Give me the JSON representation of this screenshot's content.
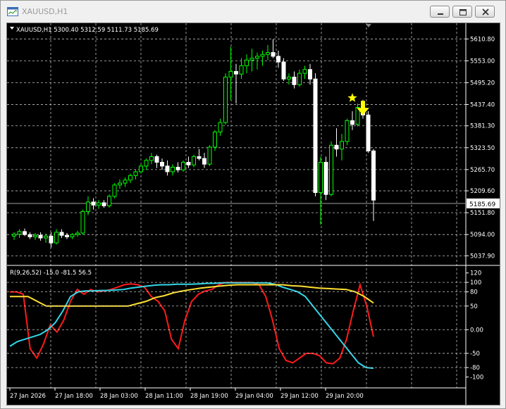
{
  "window": {
    "title": "XAUUSD,H1"
  },
  "chart_header": {
    "text": "XAUUSD,H1  5300.40 5312.59 5111.73 5185.69"
  },
  "price_axis": {
    "ticks": [
      "5610.80",
      "5553.00",
      "5495.20",
      "5437.40",
      "5381.30",
      "5323.50",
      "5265.70",
      "5209.60",
      "5151.80",
      "5094.00",
      "5037.90"
    ],
    "current_price": "5185.69"
  },
  "indicator": {
    "header": "R(9,26,52) -15.0 -81.5 56.5",
    "ticks": [
      "120",
      "100",
      "80",
      "50",
      "0.00",
      "-50",
      "-80",
      "-100"
    ]
  },
  "time_axis": {
    "labels": [
      "27 Jan 2026",
      "27 Jan 18:00",
      "28 Jan 03:00",
      "28 Jan 11:00",
      "28 Jan 19:00",
      "29 Jan 04:00",
      "29 Jan 12:00",
      "29 Jan 20:00"
    ]
  },
  "colors": {
    "background": "#000000",
    "grid": "#c0c0c0",
    "bull_candle": "#000000",
    "bull_outline": "#00ff00",
    "bear_candle": "#ffffff",
    "axis_text": "#ffffff",
    "red_line": "#ff1a1a",
    "cyan_line": "#33d6e8",
    "yellow_line": "#ffe033",
    "marker": "#ffff00"
  },
  "chart_data": {
    "type": "candlestick",
    "symbol": "XAUUSD",
    "timeframe": "H1",
    "ylim": [
      5020,
      5630
    ],
    "candles": [
      {
        "o": 5090,
        "h": 5100,
        "l": 5080,
        "c": 5095
      },
      {
        "o": 5095,
        "h": 5108,
        "l": 5085,
        "c": 5102
      },
      {
        "o": 5102,
        "h": 5110,
        "l": 5090,
        "c": 5094
      },
      {
        "o": 5094,
        "h": 5100,
        "l": 5082,
        "c": 5088
      },
      {
        "o": 5088,
        "h": 5098,
        "l": 5080,
        "c": 5092
      },
      {
        "o": 5092,
        "h": 5100,
        "l": 5078,
        "c": 5085
      },
      {
        "o": 5085,
        "h": 5096,
        "l": 5072,
        "c": 5090
      },
      {
        "o": 5090,
        "h": 5100,
        "l": 5060,
        "c": 5072
      },
      {
        "o": 5072,
        "h": 5108,
        "l": 5068,
        "c": 5100
      },
      {
        "o": 5100,
        "h": 5108,
        "l": 5085,
        "c": 5092
      },
      {
        "o": 5092,
        "h": 5098,
        "l": 5082,
        "c": 5088
      },
      {
        "o": 5088,
        "h": 5098,
        "l": 5082,
        "c": 5094
      },
      {
        "o": 5094,
        "h": 5104,
        "l": 5088,
        "c": 5098
      },
      {
        "o": 5098,
        "h": 5160,
        "l": 5094,
        "c": 5155
      },
      {
        "o": 5155,
        "h": 5195,
        "l": 5145,
        "c": 5180
      },
      {
        "o": 5180,
        "h": 5190,
        "l": 5160,
        "c": 5172
      },
      {
        "o": 5172,
        "h": 5185,
        "l": 5162,
        "c": 5178
      },
      {
        "o": 5178,
        "h": 5185,
        "l": 5165,
        "c": 5170
      },
      {
        "o": 5170,
        "h": 5200,
        "l": 5165,
        "c": 5195
      },
      {
        "o": 5195,
        "h": 5230,
        "l": 5190,
        "c": 5225
      },
      {
        "o": 5225,
        "h": 5240,
        "l": 5215,
        "c": 5230
      },
      {
        "o": 5230,
        "h": 5245,
        "l": 5220,
        "c": 5238
      },
      {
        "o": 5238,
        "h": 5255,
        "l": 5230,
        "c": 5250
      },
      {
        "o": 5250,
        "h": 5265,
        "l": 5240,
        "c": 5260
      },
      {
        "o": 5260,
        "h": 5280,
        "l": 5255,
        "c": 5275
      },
      {
        "o": 5275,
        "h": 5295,
        "l": 5265,
        "c": 5290
      },
      {
        "o": 5290,
        "h": 5310,
        "l": 5280,
        "c": 5300
      },
      {
        "o": 5300,
        "h": 5305,
        "l": 5270,
        "c": 5285
      },
      {
        "o": 5285,
        "h": 5295,
        "l": 5265,
        "c": 5275
      },
      {
        "o": 5275,
        "h": 5290,
        "l": 5250,
        "c": 5260
      },
      {
        "o": 5260,
        "h": 5280,
        "l": 5250,
        "c": 5272
      },
      {
        "o": 5272,
        "h": 5285,
        "l": 5258,
        "c": 5265
      },
      {
        "o": 5265,
        "h": 5290,
        "l": 5260,
        "c": 5285
      },
      {
        "o": 5285,
        "h": 5300,
        "l": 5270,
        "c": 5278
      },
      {
        "o": 5278,
        "h": 5305,
        "l": 5272,
        "c": 5300
      },
      {
        "o": 5300,
        "h": 5320,
        "l": 5290,
        "c": 5295
      },
      {
        "o": 5295,
        "h": 5310,
        "l": 5270,
        "c": 5280
      },
      {
        "o": 5280,
        "h": 5330,
        "l": 5275,
        "c": 5325
      },
      {
        "o": 5325,
        "h": 5370,
        "l": 5315,
        "c": 5365
      },
      {
        "o": 5365,
        "h": 5400,
        "l": 5355,
        "c": 5390
      },
      {
        "o": 5390,
        "h": 5520,
        "l": 5385,
        "c": 5510
      },
      {
        "o": 5510,
        "h": 5590,
        "l": 5450,
        "c": 5525
      },
      {
        "o": 5525,
        "h": 5545,
        "l": 5440,
        "c": 5518
      },
      {
        "o": 5518,
        "h": 5560,
        "l": 5505,
        "c": 5540
      },
      {
        "o": 5540,
        "h": 5570,
        "l": 5520,
        "c": 5555
      },
      {
        "o": 5555,
        "h": 5585,
        "l": 5525,
        "c": 5560
      },
      {
        "o": 5560,
        "h": 5575,
        "l": 5530,
        "c": 5565
      },
      {
        "o": 5565,
        "h": 5580,
        "l": 5540,
        "c": 5570
      },
      {
        "o": 5570,
        "h": 5595,
        "l": 5555,
        "c": 5575
      },
      {
        "o": 5575,
        "h": 5610,
        "l": 5560,
        "c": 5565
      },
      {
        "o": 5565,
        "h": 5580,
        "l": 5535,
        "c": 5550
      },
      {
        "o": 5550,
        "h": 5560,
        "l": 5500,
        "c": 5505
      },
      {
        "o": 5505,
        "h": 5520,
        "l": 5490,
        "c": 5510
      },
      {
        "o": 5510,
        "h": 5525,
        "l": 5480,
        "c": 5490
      },
      {
        "o": 5490,
        "h": 5530,
        "l": 5485,
        "c": 5520
      },
      {
        "o": 5520,
        "h": 5540,
        "l": 5505,
        "c": 5530
      },
      {
        "o": 5530,
        "h": 5545,
        "l": 5490,
        "c": 5505
      },
      {
        "o": 5505,
        "h": 5520,
        "l": 5195,
        "c": 5205
      },
      {
        "o": 5205,
        "h": 5300,
        "l": 5120,
        "c": 5285
      },
      {
        "o": 5285,
        "h": 5300,
        "l": 5185,
        "c": 5200
      },
      {
        "o": 5200,
        "h": 5340,
        "l": 5195,
        "c": 5330
      },
      {
        "o": 5330,
        "h": 5375,
        "l": 5300,
        "c": 5320
      },
      {
        "o": 5320,
        "h": 5360,
        "l": 5290,
        "c": 5340
      },
      {
        "o": 5340,
        "h": 5400,
        "l": 5330,
        "c": 5395
      },
      {
        "o": 5395,
        "h": 5420,
        "l": 5370,
        "c": 5385
      },
      {
        "o": 5385,
        "h": 5440,
        "l": 5380,
        "c": 5430
      },
      {
        "o": 5430,
        "h": 5450,
        "l": 5400,
        "c": 5410
      },
      {
        "o": 5410,
        "h": 5420,
        "l": 5310,
        "c": 5315
      },
      {
        "o": 5315,
        "h": 5320,
        "l": 5130,
        "c": 5185
      }
    ],
    "current_price": 5185.69,
    "markers": [
      {
        "type": "star",
        "candle": 64,
        "price": 5455
      },
      {
        "type": "arrow-down",
        "candle": 66,
        "price": 5425
      }
    ],
    "indicator": {
      "name": "R(9,26,52)",
      "ylim": [
        -120,
        130
      ],
      "series": [
        {
          "values": [
            80,
            80,
            75,
            -40,
            -60,
            -30,
            10,
            -5,
            20,
            60,
            85,
            75,
            85,
            80,
            82,
            85,
            90,
            95,
            97,
            95,
            90,
            70,
            60,
            40,
            -20,
            -40,
            20,
            60,
            75,
            82,
            85,
            95,
            100,
            100,
            100,
            100,
            100,
            95,
            70,
            20,
            -40,
            -65,
            -70,
            -60,
            -50,
            -50,
            -55,
            -70,
            -72,
            -60,
            -20,
            40,
            95,
            50,
            -15
          ]
        },
        {
          "values": [
            -35,
            -25,
            -20,
            -15,
            -10,
            0,
            15,
            40,
            70,
            80,
            82,
            82,
            83,
            83,
            84,
            85,
            88,
            90,
            92,
            94,
            95,
            95,
            96,
            96,
            96,
            97,
            98,
            98,
            99,
            99,
            99,
            99,
            99,
            99,
            99,
            96,
            90,
            85,
            80,
            70,
            50,
            30,
            10,
            -10,
            -30,
            -50,
            -70,
            -80,
            -81.5
          ]
        },
        {
          "values": [
            70,
            70,
            70,
            60,
            50,
            50,
            50,
            50,
            50,
            50,
            50,
            50,
            50,
            50,
            55,
            60,
            68,
            72,
            78,
            82,
            85,
            88,
            90,
            92,
            94,
            95,
            95,
            95,
            95,
            95,
            95,
            93,
            92,
            90,
            88,
            87,
            86,
            85,
            80,
            70,
            56.5
          ]
        }
      ]
    }
  }
}
